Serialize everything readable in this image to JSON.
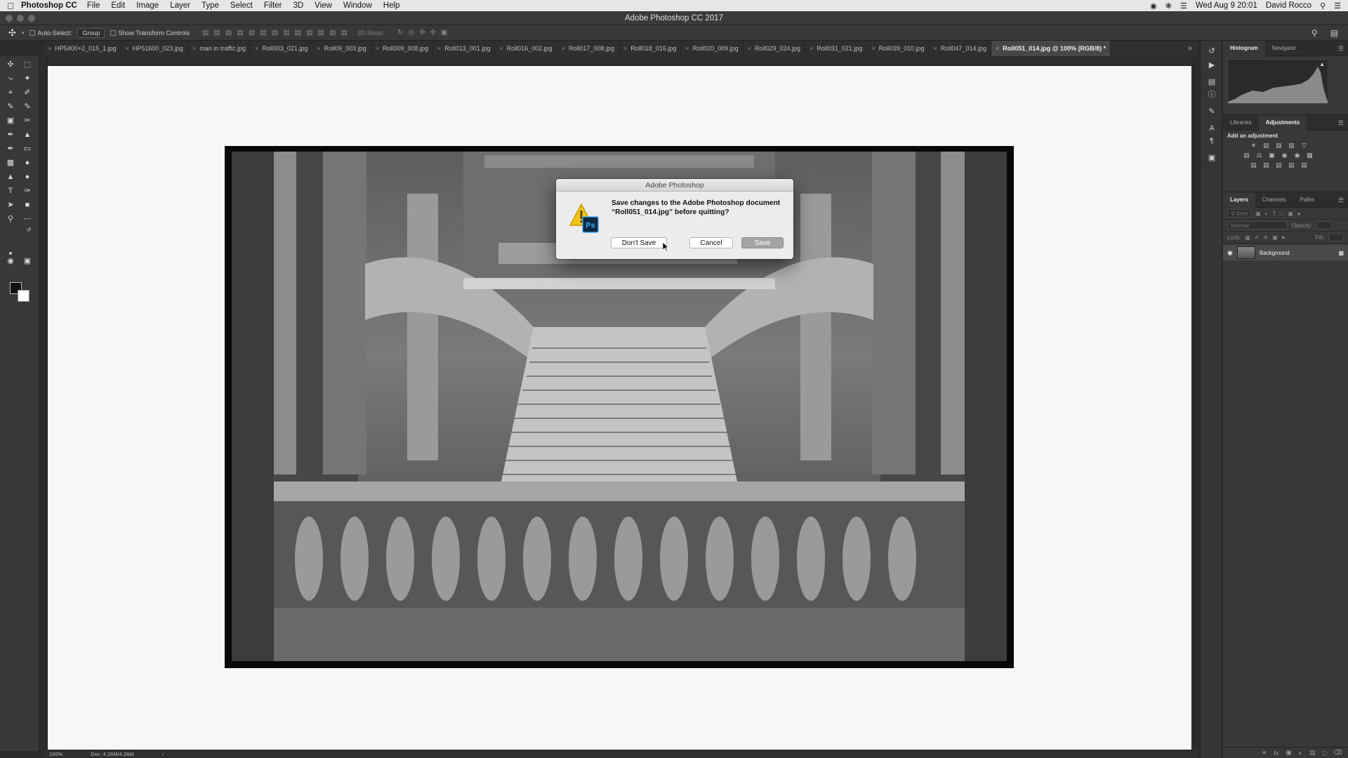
{
  "menubar": {
    "app_name": "Photoshop CC",
    "items": [
      "File",
      "Edit",
      "Image",
      "Layer",
      "Type",
      "Select",
      "Filter",
      "3D",
      "View",
      "Window",
      "Help"
    ],
    "datetime": "Wed Aug 9  20:01",
    "user": "David Rocco"
  },
  "window": {
    "title": "Adobe Photoshop CC 2017"
  },
  "options": {
    "auto_select_label": "Auto-Select:",
    "auto_select_value": "Group",
    "transform_label": "Show Transform Controls",
    "mode_3d": "3D Mode:"
  },
  "tabs": [
    {
      "label": "HP5400+2_015_1.jpg"
    },
    {
      "label": "HP51600_023.jpg"
    },
    {
      "label": "man in traffic.jpg"
    },
    {
      "label": "Roll003_021.jpg"
    },
    {
      "label": "Roll09_003.jpg"
    },
    {
      "label": "Roll009_008.jpg"
    },
    {
      "label": "Roll013_001.jpg"
    },
    {
      "label": "Roll016_002.jpg"
    },
    {
      "label": "Roll017_008.jpg"
    },
    {
      "label": "Roll018_016.jpg"
    },
    {
      "label": "Roll020_009.jpg"
    },
    {
      "label": "Roll029_024.jpg"
    },
    {
      "label": "Roll031_021.jpg"
    },
    {
      "label": "Roll039_010.jpg"
    },
    {
      "label": "Roll047_014.jpg"
    },
    {
      "label": "Roll051_014.jpg @ 100% (RGB/8) *",
      "active": true
    }
  ],
  "status": {
    "zoom": "100%",
    "doc": "Doc: 4.26M/4.26M"
  },
  "panels": {
    "histogram_tab": "Histogram",
    "navigator_tab": "Navigator",
    "libraries_tab": "Libraries",
    "adjustments_tab": "Adjustments",
    "add_adjustment": "Add an adjustment",
    "layers_tab": "Layers",
    "channels_tab": "Channels",
    "paths_tab": "Paths",
    "kind_placeholder": "Kind",
    "blend_mode": "Normal",
    "opacity_label": "Opacity:",
    "lock_label": "Lock:",
    "fill_label": "Fill:",
    "layer_name": "Background"
  },
  "dialog": {
    "title": "Adobe Photoshop",
    "message": "Save changes to the Adobe Photoshop document “Roll051_014.jpg” before quitting?",
    "dont_save": "Don't Save",
    "cancel": "Cancel",
    "save": "Save"
  }
}
